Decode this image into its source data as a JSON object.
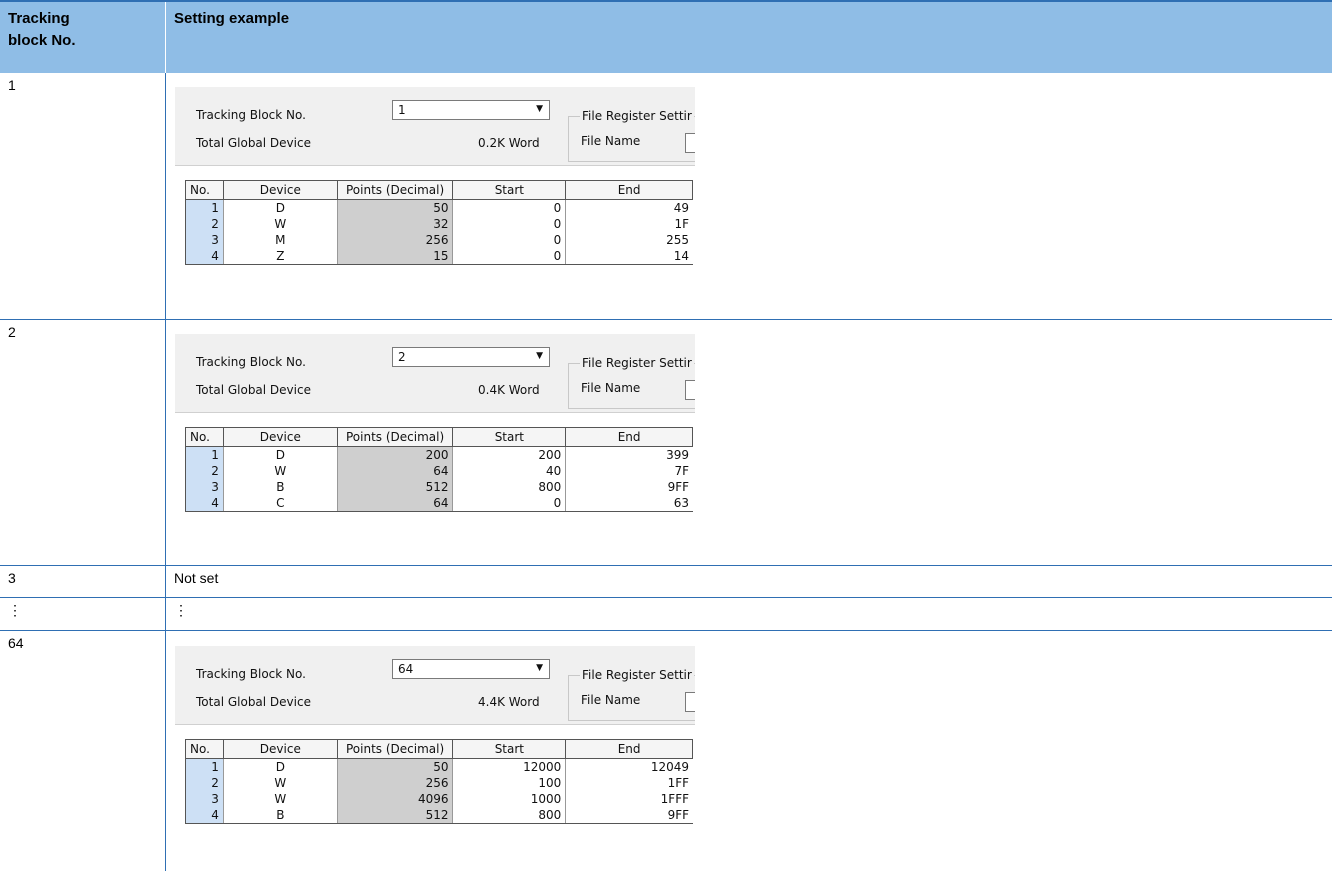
{
  "header": {
    "col1_line1": "Tracking",
    "col1_line2": "block No.",
    "col2": "Setting example"
  },
  "panel_labels": {
    "tracking_block": "Tracking Block No.",
    "total_global": "Total Global Device",
    "file_register": "File Register Settir",
    "file_name": "File Name",
    "col_no": "No.",
    "col_device": "Device",
    "col_points": "Points (Decimal)",
    "col_start": "Start",
    "col_end": "End"
  },
  "rows": [
    {
      "block_no": "1",
      "panel": {
        "combo_value": "1",
        "total": "0.2K Word",
        "entries": [
          {
            "no": "1",
            "device": "D",
            "points": "50",
            "start": "0",
            "end": "49"
          },
          {
            "no": "2",
            "device": "W",
            "points": "32",
            "start": "0",
            "end": "1F"
          },
          {
            "no": "3",
            "device": "M",
            "points": "256",
            "start": "0",
            "end": "255"
          },
          {
            "no": "4",
            "device": "Z",
            "points": "15",
            "start": "0",
            "end": "14"
          }
        ]
      }
    },
    {
      "block_no": "2",
      "panel": {
        "combo_value": "2",
        "total": "0.4K Word",
        "entries": [
          {
            "no": "1",
            "device": "D",
            "points": "200",
            "start": "200",
            "end": "399"
          },
          {
            "no": "2",
            "device": "W",
            "points": "64",
            "start": "40",
            "end": "7F"
          },
          {
            "no": "3",
            "device": "B",
            "points": "512",
            "start": "800",
            "end": "9FF"
          },
          {
            "no": "4",
            "device": "C",
            "points": "64",
            "start": "0",
            "end": "63"
          }
        ]
      }
    },
    {
      "block_no": "3",
      "text": "Not set"
    },
    {
      "block_no": "⋮",
      "text": "⋮"
    },
    {
      "block_no": "64",
      "panel": {
        "combo_value": "64",
        "total": "4.4K Word",
        "entries": [
          {
            "no": "1",
            "device": "D",
            "points": "50",
            "start": "12000",
            "end": "12049"
          },
          {
            "no": "2",
            "device": "W",
            "points": "256",
            "start": "100",
            "end": "1FF"
          },
          {
            "no": "3",
            "device": "W",
            "points": "4096",
            "start": "1000",
            "end": "1FFF"
          },
          {
            "no": "4",
            "device": "B",
            "points": "512",
            "start": "800",
            "end": "9FF"
          }
        ]
      }
    }
  ]
}
